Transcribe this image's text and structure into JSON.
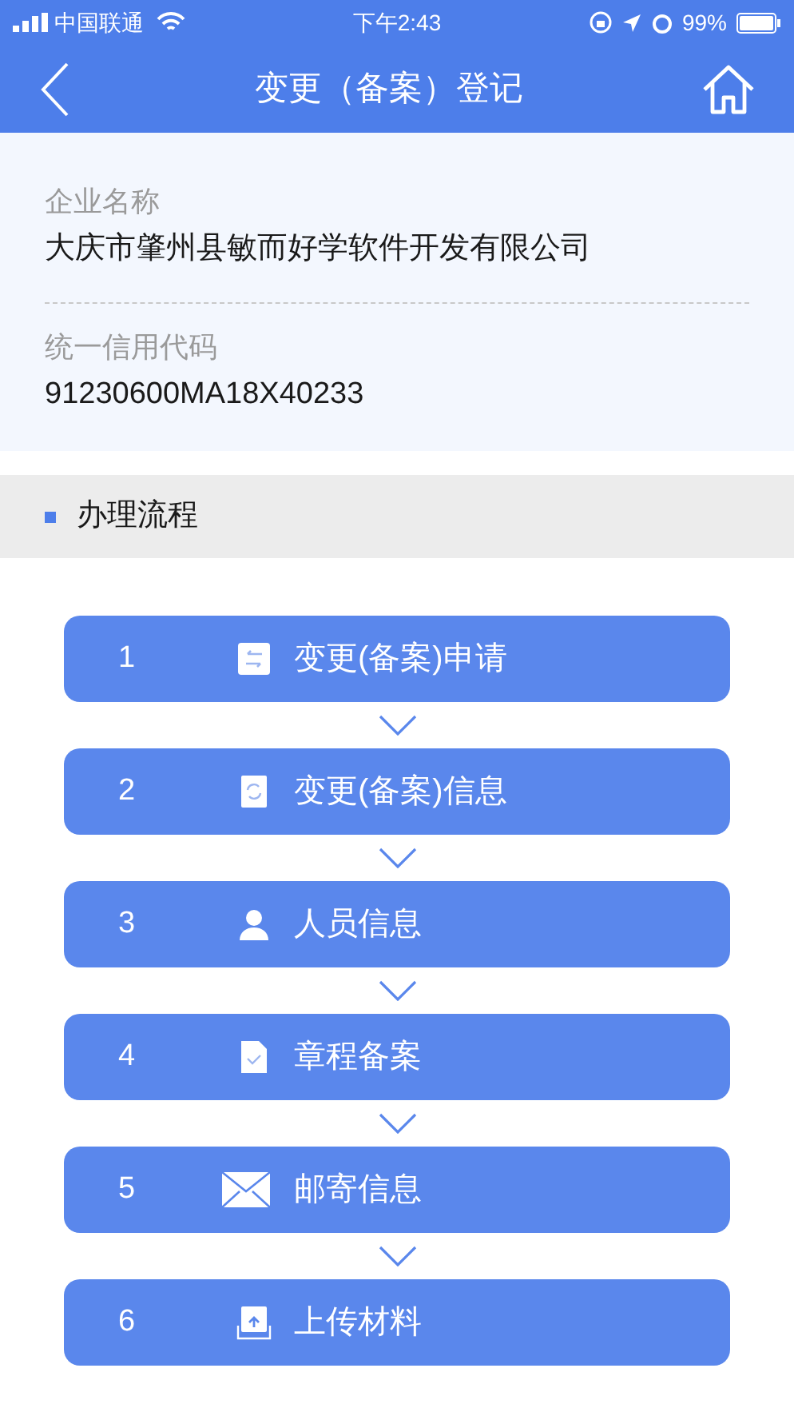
{
  "status_bar": {
    "carrier": "中国联通",
    "time": "下午2:43",
    "battery": "99%"
  },
  "nav": {
    "title": "变更（备案）登记"
  },
  "company": [
    {
      "label": "企业名称",
      "value": "大庆市肇州县敏而好学软件开发有限公司"
    },
    {
      "label": "统一信用代码",
      "value": "91230600MA18X40233"
    }
  ],
  "section": {
    "title": "办理流程"
  },
  "steps": [
    {
      "number": "1",
      "label": "变更(备案)申请",
      "kind": "swap"
    },
    {
      "number": "2",
      "label": "变更(备案)信息",
      "kind": "refresh"
    },
    {
      "number": "3",
      "label": "人员信息",
      "kind": "person"
    },
    {
      "number": "4",
      "label": "章程备案",
      "kind": "document"
    },
    {
      "number": "5",
      "label": "邮寄信息",
      "kind": "mail"
    },
    {
      "number": "6",
      "label": "上传材料",
      "kind": "upload"
    }
  ]
}
